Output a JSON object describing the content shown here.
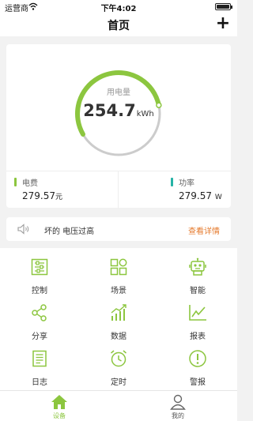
{
  "status_bar": {
    "carrier": "运营商",
    "time": "下午4:02"
  },
  "nav": {
    "title": "首页",
    "add_label": "+"
  },
  "energy": {
    "label": "用电量",
    "value": "254.7",
    "unit": "kWh",
    "progress_fraction": 0.55,
    "accent_color": "#8cc63f",
    "track_color": "#cccccc"
  },
  "stats": {
    "cost": {
      "label": "电费",
      "value": "279.57",
      "unit": "元",
      "color": "#8cc63f"
    },
    "power": {
      "label": "功率",
      "value": "279.57",
      "unit": "W",
      "color": "#26b3a6"
    }
  },
  "alert": {
    "icon": "speaker-icon",
    "message": "坏的 电压过高",
    "link_label": "查看详情",
    "link_color": "#e57a2c"
  },
  "menu": [
    {
      "label": "控制",
      "icon": "sliders-icon"
    },
    {
      "label": "场景",
      "icon": "scenes-icon"
    },
    {
      "label": "智能",
      "icon": "robot-icon"
    },
    {
      "label": "分享",
      "icon": "share-icon"
    },
    {
      "label": "数据",
      "icon": "data-chart-icon"
    },
    {
      "label": "报表",
      "icon": "report-icon"
    },
    {
      "label": "日志",
      "icon": "log-icon"
    },
    {
      "label": "定时",
      "icon": "alarm-clock-icon"
    },
    {
      "label": "警报",
      "icon": "alert-icon"
    }
  ],
  "tabs": [
    {
      "label": "设备",
      "icon": "home-icon",
      "active": true,
      "color": "#8cc63f"
    },
    {
      "label": "我的",
      "icon": "user-icon",
      "active": false,
      "color": "#555555"
    }
  ]
}
